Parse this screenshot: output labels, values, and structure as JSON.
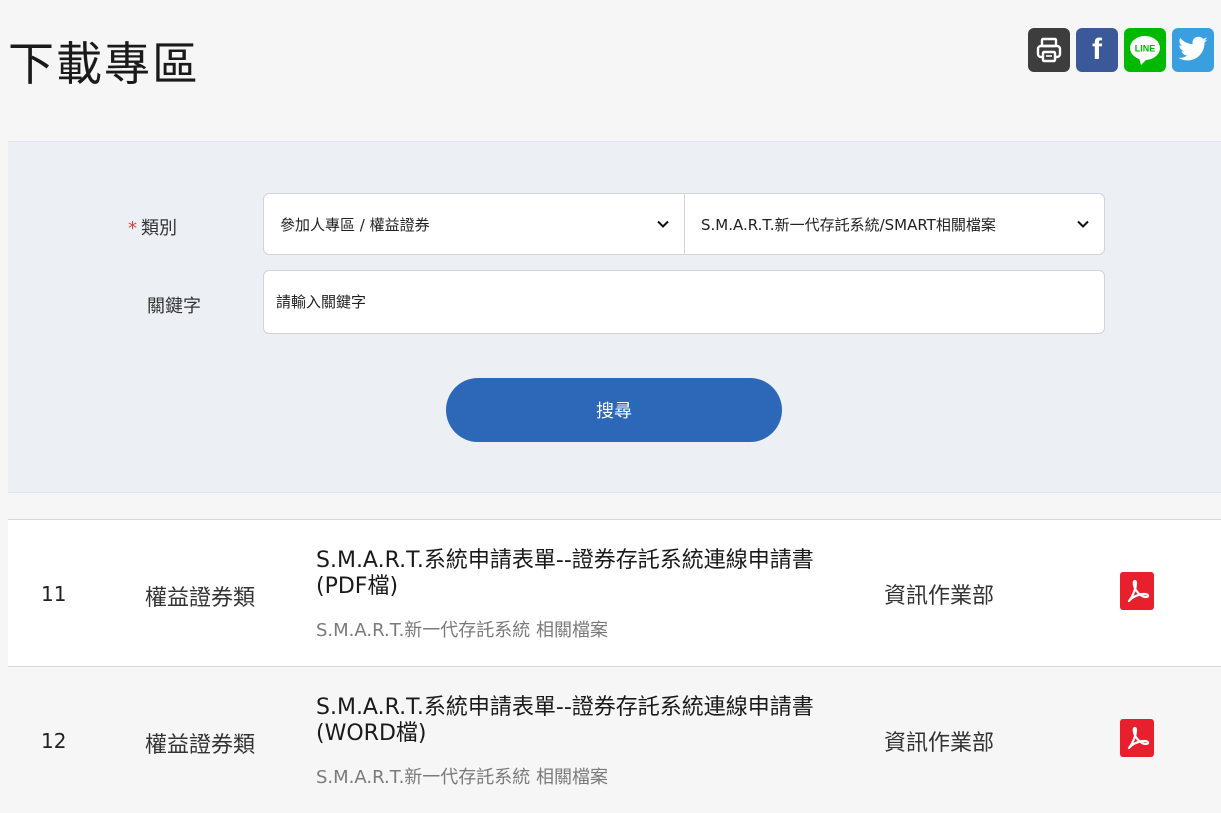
{
  "page": {
    "title": "下載專區"
  },
  "share": {
    "icons": [
      "print-icon",
      "facebook-icon",
      "line-icon",
      "twitter-icon"
    ],
    "line_text": "LINE",
    "facebook_letter": "f",
    "colors": {
      "print": "#3d3d3d",
      "facebook": "#3b5998",
      "line": "#00b900",
      "twitter": "#3a9fe0"
    }
  },
  "search": {
    "category_label": "類別",
    "required_mark": "*",
    "category_primary": "參加人專區 / 權益證券",
    "category_secondary": "S.M.A.R.T.新一代存託系統/SMART相關檔案",
    "keyword_label": "關鍵字",
    "keyword_placeholder": "請輸入關鍵字",
    "keyword_value": "",
    "search_label": "搜尋"
  },
  "results": [
    {
      "num": "11",
      "category": "權益證券類",
      "title": "S.M.A.R.T.系統申請表單--證券存託系統連線申請書(PDF檔)",
      "subtitle": "S.M.A.R.T.新一代存託系統 相關檔案",
      "department": "資訊作業部",
      "file_icon": "pdf-icon"
    },
    {
      "num": "12",
      "category": "權益證券類",
      "title": "S.M.A.R.T.系統申請表單--證券存託系統連線申請書(WORD檔)",
      "subtitle": "S.M.A.R.T.新一代存託系統 相關檔案",
      "department": "資訊作業部",
      "file_icon": "pdf-icon"
    }
  ],
  "colors": {
    "accent": "#2c67b8",
    "pdf_red": "#e8202e",
    "panel_bg": "#eceff3",
    "page_bg": "#f6f6f6"
  }
}
